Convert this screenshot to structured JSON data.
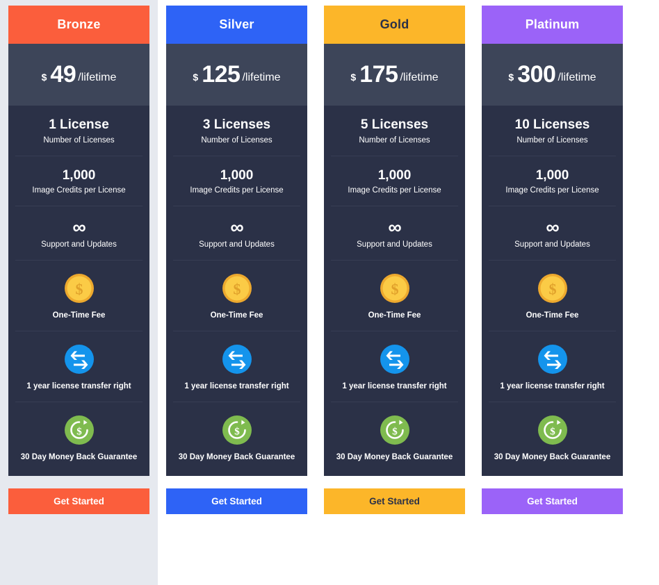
{
  "table": {
    "currency_symbol": "$",
    "period_label": "/lifetime",
    "cta_label": "Get Started",
    "background": "#ffffff",
    "featured_panel_color": "#e6e9ef",
    "price_band_color": "#3d4559",
    "features_bg_color": "#2b3147",
    "divider_color": "#373d54"
  },
  "icons": {
    "coin": "coin-dollar-icon",
    "transfer": "transfer-arrows-icon",
    "guarantee": "money-back-refresh-icon",
    "infinity_glyph": "∞"
  },
  "plans": [
    {
      "name": "Bronze",
      "accent": "#fb5e3c",
      "header_text_color": "#ffffff",
      "cta_text_color": "#ffffff",
      "featured": true,
      "price": "49",
      "licenses_value": "1 License",
      "licenses_label": "Number of Licenses",
      "credits_value": "1,000",
      "credits_label": "Image Credits per License",
      "support_value": "∞",
      "support_label": "Support and Updates",
      "fee_label": "One-Time Fee",
      "transfer_label": "1 year license transfer right",
      "guarantee_label": "30 Day Money Back Guarantee"
    },
    {
      "name": "Silver",
      "accent": "#2e63f6",
      "header_text_color": "#ffffff",
      "cta_text_color": "#ffffff",
      "featured": false,
      "price": "125",
      "licenses_value": "3 Licenses",
      "licenses_label": "Number of Licenses",
      "credits_value": "1,000",
      "credits_label": "Image Credits per License",
      "support_value": "∞",
      "support_label": "Support and Updates",
      "fee_label": "One-Time Fee",
      "transfer_label": "1 year license transfer right",
      "guarantee_label": "30 Day Money Back Guarantee"
    },
    {
      "name": "Gold",
      "accent": "#fcb629",
      "header_text_color": "#2b3147",
      "cta_text_color": "#2b3147",
      "featured": false,
      "price": "175",
      "licenses_value": "5 Licenses",
      "licenses_label": "Number of Licenses",
      "credits_value": "1,000",
      "credits_label": "Image Credits per License",
      "support_value": "∞",
      "support_label": "Support and Updates",
      "fee_label": "One-Time Fee",
      "transfer_label": "1 year license transfer right",
      "guarantee_label": "30 Day Money Back Guarantee"
    },
    {
      "name": "Platinum",
      "accent": "#9b63f8",
      "header_text_color": "#ffffff",
      "cta_text_color": "#ffffff",
      "featured": false,
      "price": "300",
      "licenses_value": "10 Licenses",
      "licenses_label": "Number of Licenses",
      "credits_value": "1,000",
      "credits_label": "Image Credits per License",
      "support_value": "∞",
      "support_label": "Support and Updates",
      "fee_label": "One-Time Fee",
      "transfer_label": "1 year license transfer right",
      "guarantee_label": "30 Day Money Back Guarantee"
    }
  ]
}
